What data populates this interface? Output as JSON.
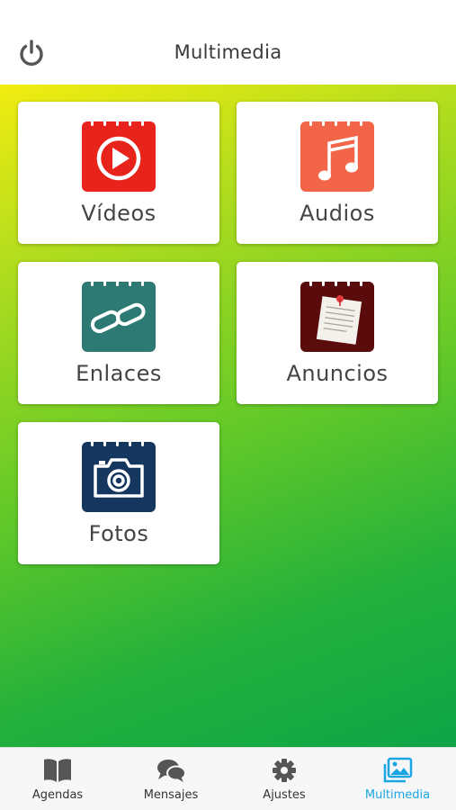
{
  "header": {
    "title": "Multimedia",
    "power_icon": "power-icon"
  },
  "tiles": [
    {
      "label": "Vídeos",
      "icon": "video-play-icon",
      "color": "#e8231c"
    },
    {
      "label": "Audios",
      "icon": "music-note-icon",
      "color": "#f36548"
    },
    {
      "label": "Enlaces",
      "icon": "link-icon",
      "color": "#2d7a75"
    },
    {
      "label": "Anuncios",
      "icon": "note-pin-icon",
      "color": "#5a0b0b"
    },
    {
      "label": "Fotos",
      "icon": "camera-icon",
      "color": "#14365f"
    }
  ],
  "tabbar": {
    "items": [
      {
        "label": "Agendas",
        "icon": "book-icon"
      },
      {
        "label": "Mensajes",
        "icon": "chat-bubbles-icon"
      },
      {
        "label": "Ajustes",
        "icon": "gear-icon"
      },
      {
        "label": "Multimedia",
        "icon": "images-icon",
        "active": true
      }
    ],
    "active_color": "#1aa6e3"
  },
  "colors": {
    "background_gradient": [
      "#f2ec10",
      "#63c928",
      "#0ea548"
    ]
  }
}
